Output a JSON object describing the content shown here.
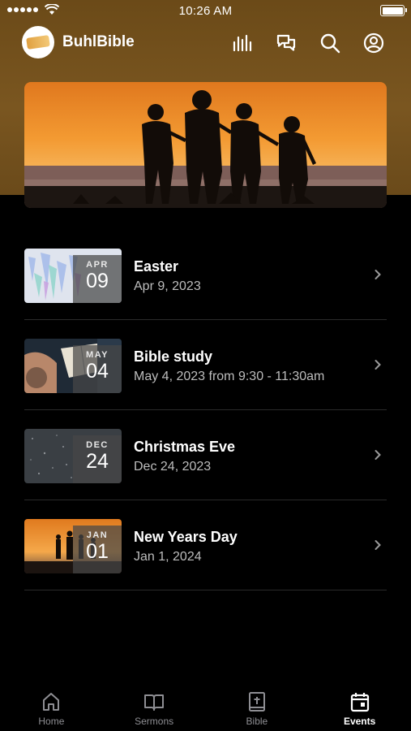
{
  "status_bar": {
    "time": "10:26 AM",
    "battery_level": 1.0
  },
  "header": {
    "app_name": "BuhlBible",
    "icons": [
      "equalizer-icon",
      "chat-icon",
      "search-icon",
      "account-icon"
    ]
  },
  "events": [
    {
      "title": "Easter",
      "date": "Apr 9, 2023",
      "month": "APR",
      "day": "09"
    },
    {
      "title": "Bible study",
      "date": "May 4, 2023 from 9:30 - 11:30am",
      "month": "MAY",
      "day": "04"
    },
    {
      "title": "Christmas Eve",
      "date": "Dec 24, 2023",
      "month": "DEC",
      "day": "24"
    },
    {
      "title": "New Years Day",
      "date": "Jan 1, 2024",
      "month": "JAN",
      "day": "01"
    }
  ],
  "tabs": [
    {
      "label": "Home",
      "icon": "home-icon",
      "active": false
    },
    {
      "label": "Sermons",
      "icon": "book-open-icon",
      "active": false
    },
    {
      "label": "Bible",
      "icon": "bible-icon",
      "active": false
    },
    {
      "label": "Events",
      "icon": "calendar-icon",
      "active": true
    }
  ],
  "colors": {
    "header_bg": "#7a5620",
    "background": "#000000",
    "inactive_tab": "#8e8e93"
  }
}
